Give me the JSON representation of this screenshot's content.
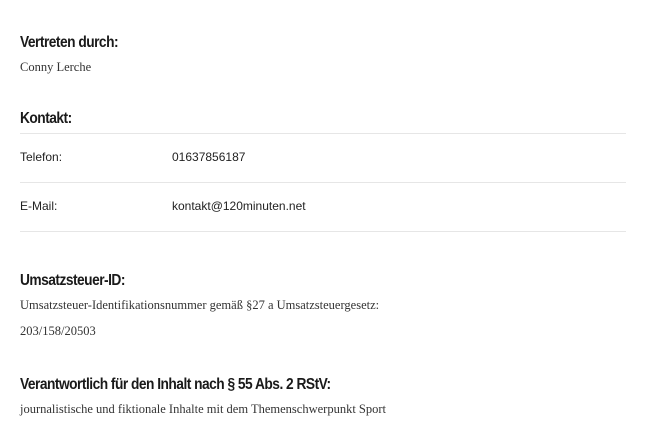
{
  "sections": {
    "represented": {
      "heading": "Vertreten durch:",
      "name": "Conny Lerche"
    },
    "contact": {
      "heading": "Kontakt:",
      "rows": [
        {
          "label": "Telefon:",
          "value": "01637856187"
        },
        {
          "label": "E-Mail:",
          "value": "kontakt@120minuten.net"
        }
      ]
    },
    "vat": {
      "heading": "Umsatzsteuer-ID:",
      "description": "Umsatzsteuer-Identifikationsnummer gemäß §27 a Umsatzsteuergesetz:",
      "number": "203/158/20503"
    },
    "responsible": {
      "heading": "Verantwortlich für den Inhalt nach § 55 Abs. 2 RStV:",
      "text": "journalistische und fiktionale Inhalte mit dem Themenschwerpunkt Sport"
    }
  }
}
